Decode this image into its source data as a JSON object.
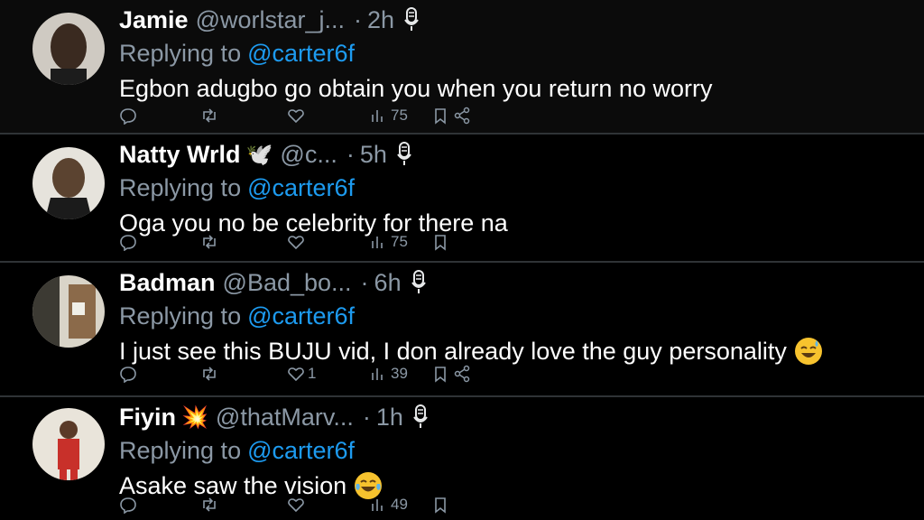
{
  "replies": [
    {
      "name": "Jamie",
      "name_emoji": "",
      "handle": "@worlstar_j...",
      "time": "2h",
      "replying_prefix": "Replying to",
      "replying_to": "@carter6f",
      "text": "Egbon adugbo go obtain you when you return no worry",
      "text_emoji": "",
      "likes": "",
      "views": "75",
      "has_share": true
    },
    {
      "name": "Natty Wrld",
      "name_emoji": "🕊️",
      "handle": "@c...",
      "time": "5h",
      "replying_prefix": "Replying to",
      "replying_to": "@carter6f",
      "text": "Oga you no be celebrity for there na",
      "text_emoji": "",
      "likes": "",
      "views": "75",
      "has_share": false
    },
    {
      "name": "Badman",
      "name_emoji": "",
      "handle": "@Bad_bo...",
      "time": "6h",
      "replying_prefix": "Replying to",
      "replying_to": "@carter6f",
      "text": "I just see this BUJU vid, I don already love the guy personality",
      "text_emoji": "sweat-smile-emoji",
      "likes": "1",
      "views": "39",
      "has_share": true
    },
    {
      "name": "Fiyin",
      "name_emoji": "💥",
      "handle": "@thatMarv...",
      "time": "1h",
      "replying_prefix": "Replying to",
      "replying_to": "@carter6f",
      "text": "Asake saw the vision",
      "text_emoji": "tears-of-joy-emoji",
      "likes": "",
      "views": "49",
      "has_share": false
    }
  ],
  "colors": {
    "background": "#000000",
    "secondary_text": "#8b98a5",
    "mention": "#1d9bf0",
    "divider": "#2f3336"
  }
}
